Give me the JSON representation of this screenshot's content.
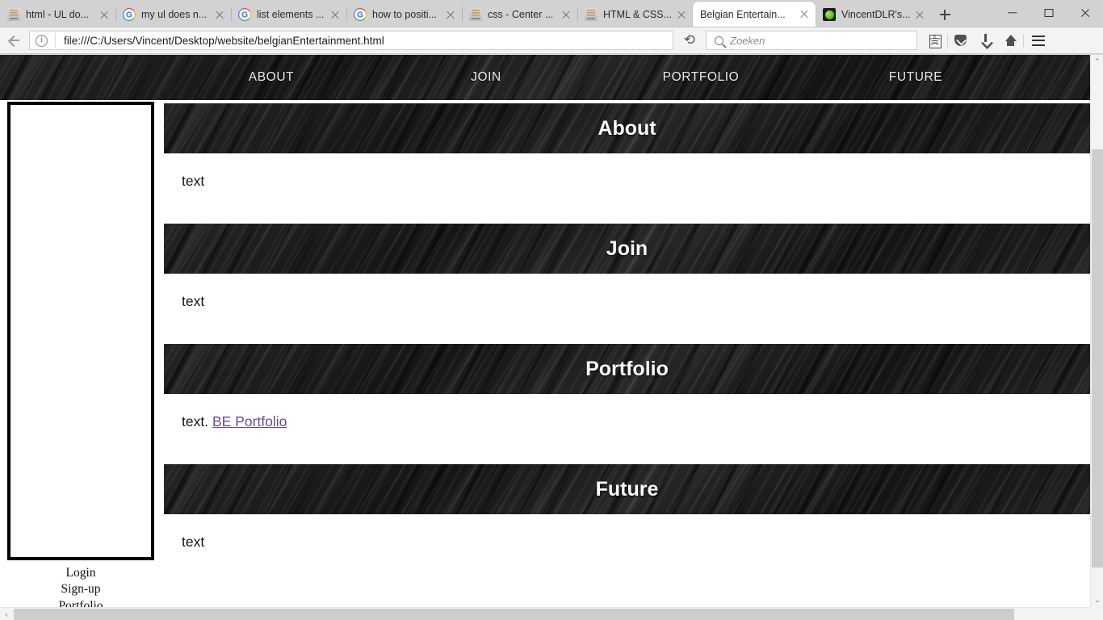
{
  "browser": {
    "tabs": [
      {
        "title": "html - UL do...",
        "favicon": "stackoverflow-icon",
        "active": false
      },
      {
        "title": "my ul does n...",
        "favicon": "google-icon",
        "active": false
      },
      {
        "title": "list elements ...",
        "favicon": "google-icon",
        "active": false
      },
      {
        "title": "how to positi...",
        "favicon": "google-icon",
        "active": false
      },
      {
        "title": "css - Center ...",
        "favicon": "stackoverflow-icon",
        "active": false
      },
      {
        "title": "HTML & CSS...",
        "favicon": "stackoverflow-icon",
        "active": false
      },
      {
        "title": "Belgian Entertain...",
        "favicon": "none",
        "active": true
      },
      {
        "title": "VincentDLR's...",
        "favicon": "green-circle-icon",
        "active": false
      }
    ],
    "new_tab_label": "+",
    "window_controls": {
      "minimize": "–",
      "maximize": "❐",
      "close": "✕"
    },
    "address_bar": {
      "url": "file:///C:/Users/Vincent/Desktop/website/belgianEntertainment.html",
      "back_tooltip": "Back",
      "info_label": "i",
      "reload_label": "Reload"
    },
    "search_bar": {
      "placeholder": "Zoeken",
      "value": ""
    },
    "toolbar_icons": [
      "bookmark-star-icon",
      "library-icon",
      "pocket-icon",
      "downloads-icon",
      "home-icon",
      "hamburger-menu-icon"
    ]
  },
  "page": {
    "nav": [
      {
        "label": "ABOUT",
        "href": "#about"
      },
      {
        "label": "JOIN",
        "href": "#join"
      },
      {
        "label": "PORTFOLIO",
        "href": "#portfolio"
      },
      {
        "label": "FUTURE",
        "href": "#future"
      }
    ],
    "side_panel": {
      "content": ""
    },
    "side_menu": [
      {
        "label": "Login"
      },
      {
        "label": "Sign-up"
      },
      {
        "label": "Portfolio"
      }
    ],
    "sections": [
      {
        "heading": "About",
        "body": "text",
        "link": null
      },
      {
        "heading": "Join",
        "body": "text",
        "link": null
      },
      {
        "heading": "Portfolio",
        "body": "text.",
        "link": "BE Portfolio"
      },
      {
        "heading": "Future",
        "body": "text",
        "link": null
      }
    ],
    "colors": {
      "header_bg": "#1a1a1a",
      "header_text": "#ffffff",
      "nav_text": "#f2ece0",
      "link": "#6a4a8f",
      "panel_border": "#000000",
      "page_bg": "#ffffff"
    }
  },
  "scrollbars": {
    "vertical": {
      "up_arrow": "⌃",
      "down_arrow": "⌄"
    },
    "horizontal": {
      "left_arrow": "‹",
      "right_arrow": "›"
    }
  }
}
